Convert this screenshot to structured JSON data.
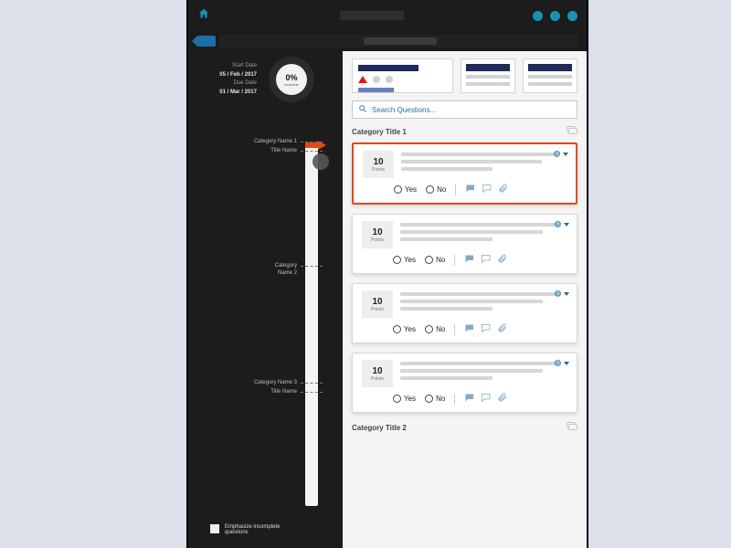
{
  "dates": {
    "start_label": "Start Date",
    "start_value": "05 / Feb / 2017",
    "due_label": "Due Date",
    "due_value": "01 / Mar / 2017"
  },
  "progress": {
    "percent": "0%",
    "sub": "complete"
  },
  "nav": {
    "cat1": "Category Name 1",
    "cat1_sub": "Title Name",
    "cat2_l1": "Category",
    "cat2_l2": "Name 2",
    "cat3": "Category Name 3",
    "cat3_sub": "Title Name"
  },
  "emphasize": {
    "line1": "Emphasize incomplete",
    "line2": "questions"
  },
  "search": {
    "placeholder": "Search Questions..."
  },
  "categories": {
    "cat1_title": "Category Title 1",
    "cat2_title": "Category Title 2"
  },
  "card": {
    "points_value": "10",
    "points_label": "Points",
    "yes": "Yes",
    "no": "No"
  }
}
